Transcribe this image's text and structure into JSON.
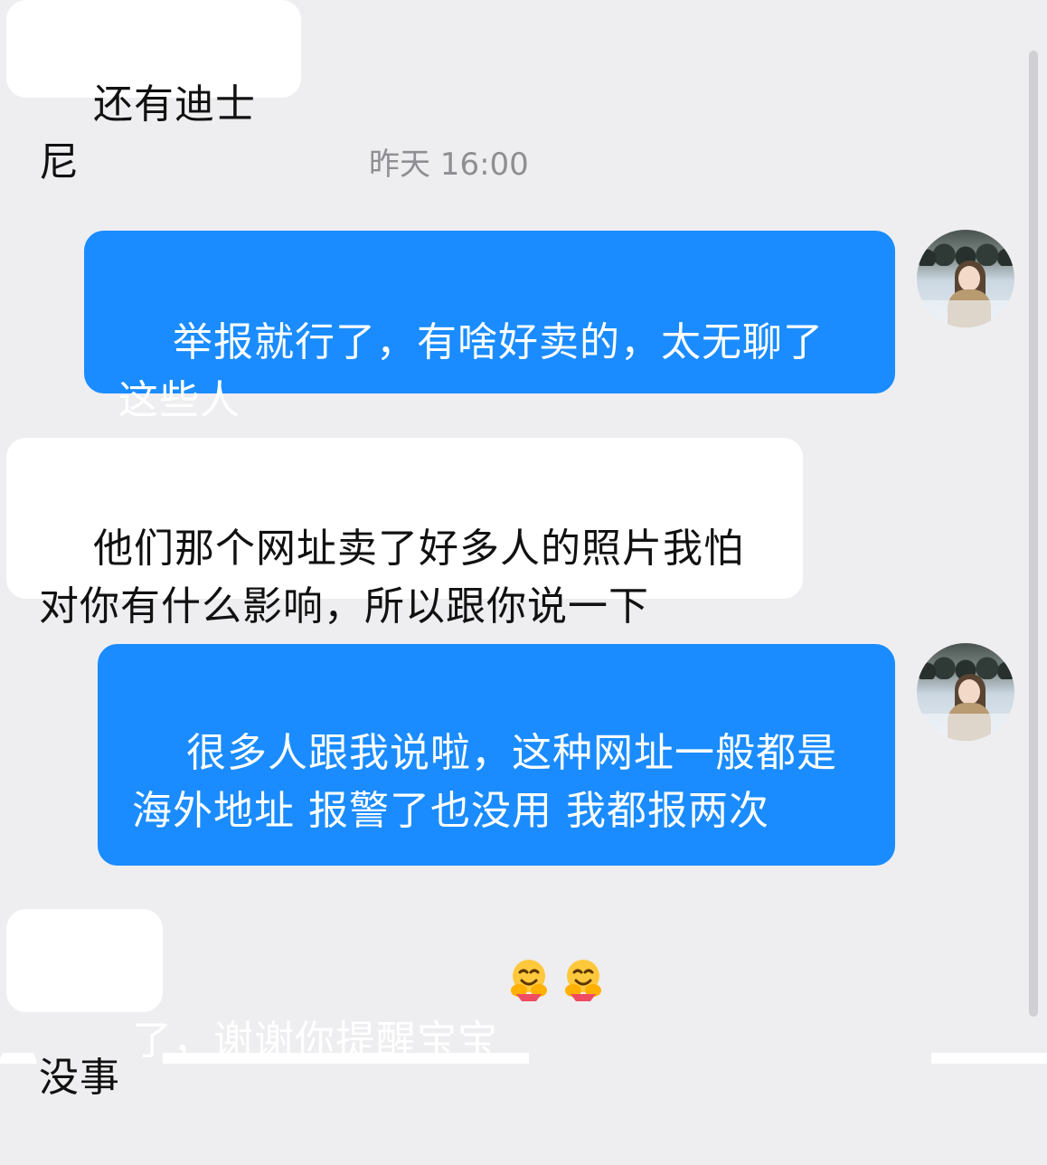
{
  "chat": {
    "timestamp": "昨天 16:00",
    "messages": [
      {
        "sender": "other",
        "text": "还有迪士尼"
      },
      {
        "sender": "self",
        "text": "举报就行了，有啥好卖的，太无聊了\n这些人"
      },
      {
        "sender": "other",
        "text": "他们那个网址卖了好多人的照片我怕\n对你有什么影响，所以跟你说一下"
      },
      {
        "sender": "self",
        "text": "很多人跟我说啦，这种网址一般都是\n海外地址 报警了也没用 我都报两次\n了，谢谢你提醒宝宝",
        "emojis": [
          "hugging-face-icon",
          "hugging-face-icon"
        ]
      },
      {
        "sender": "other",
        "text": "没事"
      }
    ]
  },
  "colors": {
    "background": "#eeeef0",
    "incoming_bubble": "#ffffff",
    "outgoing_bubble": "#1a8cff",
    "outgoing_text": "#ffffff",
    "timestamp_text": "#8e8e93"
  },
  "avatar": {
    "icon": "profile-photo"
  }
}
